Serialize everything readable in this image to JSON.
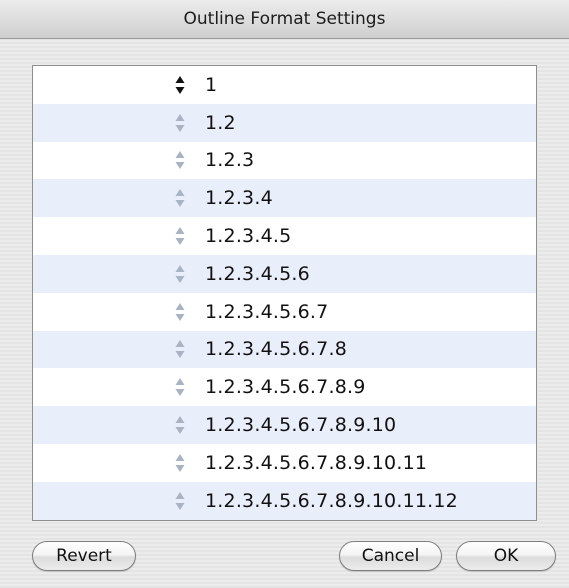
{
  "window": {
    "title": "Outline Format Settings"
  },
  "outline_levels": [
    {
      "label": "1",
      "active": true
    },
    {
      "label": "1.2",
      "active": false
    },
    {
      "label": "1.2.3",
      "active": false
    },
    {
      "label": "1.2.3.4",
      "active": false
    },
    {
      "label": "1.2.3.4.5",
      "active": false
    },
    {
      "label": "1.2.3.4.5.6",
      "active": false
    },
    {
      "label": "1.2.3.4.5.6.7",
      "active": false
    },
    {
      "label": "1.2.3.4.5.6.7.8",
      "active": false
    },
    {
      "label": "1.2.3.4.5.6.7.8.9",
      "active": false
    },
    {
      "label": "1.2.3.4.5.6.7.8.9.10",
      "active": false
    },
    {
      "label": "1.2.3.4.5.6.7.8.9.10.11",
      "active": false
    },
    {
      "label": "1.2.3.4.5.6.7.8.9.10.11.12",
      "active": false
    }
  ],
  "stepper_icon": "up-down-arrows-icon",
  "buttons": {
    "revert": "Revert",
    "cancel": "Cancel",
    "ok": "OK"
  }
}
